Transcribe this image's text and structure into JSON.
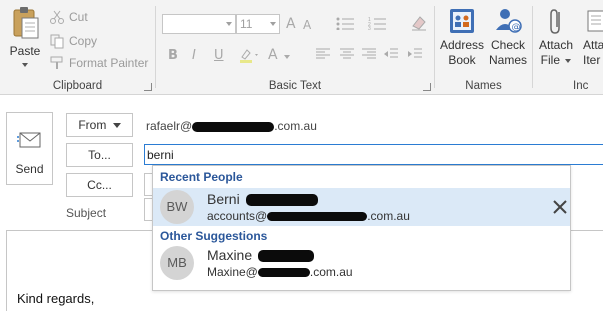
{
  "ribbon": {
    "clipboard": {
      "label": "Clipboard",
      "paste": "Paste",
      "cut": "Cut",
      "copy": "Copy",
      "format_painter": "Format Painter"
    },
    "basic_text": {
      "label": "Basic Text",
      "font_size": "11",
      "grow_font": "A",
      "shrink_font": "A",
      "bold": "B",
      "italic": "I",
      "underline": "U",
      "font_color": "A"
    },
    "names": {
      "label": "Names",
      "address_book_line1": "Address",
      "address_book_line2": "Book",
      "check_names_line1": "Check",
      "check_names_line2": "Names"
    },
    "include": {
      "label": "Inc",
      "attach_file_line1": "Attach",
      "attach_file_line2": "File",
      "attach_item_line1": "Attach",
      "attach_item_line2": "Iter"
    }
  },
  "compose": {
    "send_label": "Send",
    "from_label": "From",
    "from_address_prefix": "rafaelr@",
    "from_address_suffix": ".com.au",
    "to_label": "To...",
    "to_value": "berni",
    "cc_label": "Cc...",
    "subject_label": "Subject",
    "body_text": "Kind regards,"
  },
  "suggestions": {
    "recent_title": "Recent People",
    "other_title": "Other Suggestions",
    "recent": [
      {
        "initials": "BW",
        "name": "Berni",
        "email_prefix": "accounts@",
        "email_suffix": ".com.au"
      }
    ],
    "other": [
      {
        "initials": "MB",
        "name": "Maxine",
        "email_prefix": "Maxine@",
        "email_suffix": ".com.au"
      }
    ]
  },
  "colors": {
    "accent": "#2b579a",
    "selected_row": "#dbe9f7",
    "input_focus": "#2b7cd3"
  }
}
